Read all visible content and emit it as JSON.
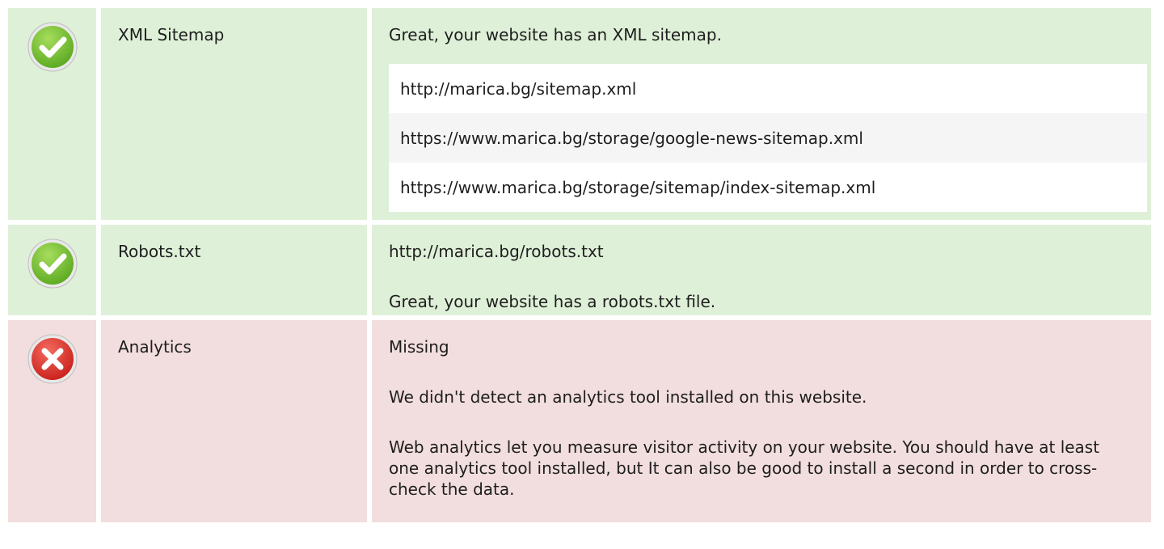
{
  "rows": [
    {
      "status": "pass",
      "status_icon": "check-circle-icon",
      "label": "XML Sitemap",
      "summary": "Great, your website has an XML sitemap.",
      "urls": [
        "http://marica.bg/sitemap.xml",
        "https://www.marica.bg/storage/google-news-sitemap.xml",
        "https://www.marica.bg/storage/sitemap/index-sitemap.xml"
      ]
    },
    {
      "status": "pass",
      "status_icon": "check-circle-icon",
      "label": "Robots.txt",
      "url": "http://marica.bg/robots.txt",
      "summary": "Great, your website has a robots.txt file."
    },
    {
      "status": "fail",
      "status_icon": "cross-circle-icon",
      "label": "Analytics",
      "state": "Missing",
      "detail": "We didn't detect an analytics tool installed on this website.",
      "advice": "Web analytics let you measure visitor activity on your website. You should have at least one analytics tool installed, but It can also be good to install a second in order to cross-check the data."
    }
  ],
  "colors": {
    "pass_bg": "#dff0d8",
    "fail_bg": "#f2dede",
    "pass_icon": "#6fbb2c",
    "fail_icon": "#d9302b"
  }
}
